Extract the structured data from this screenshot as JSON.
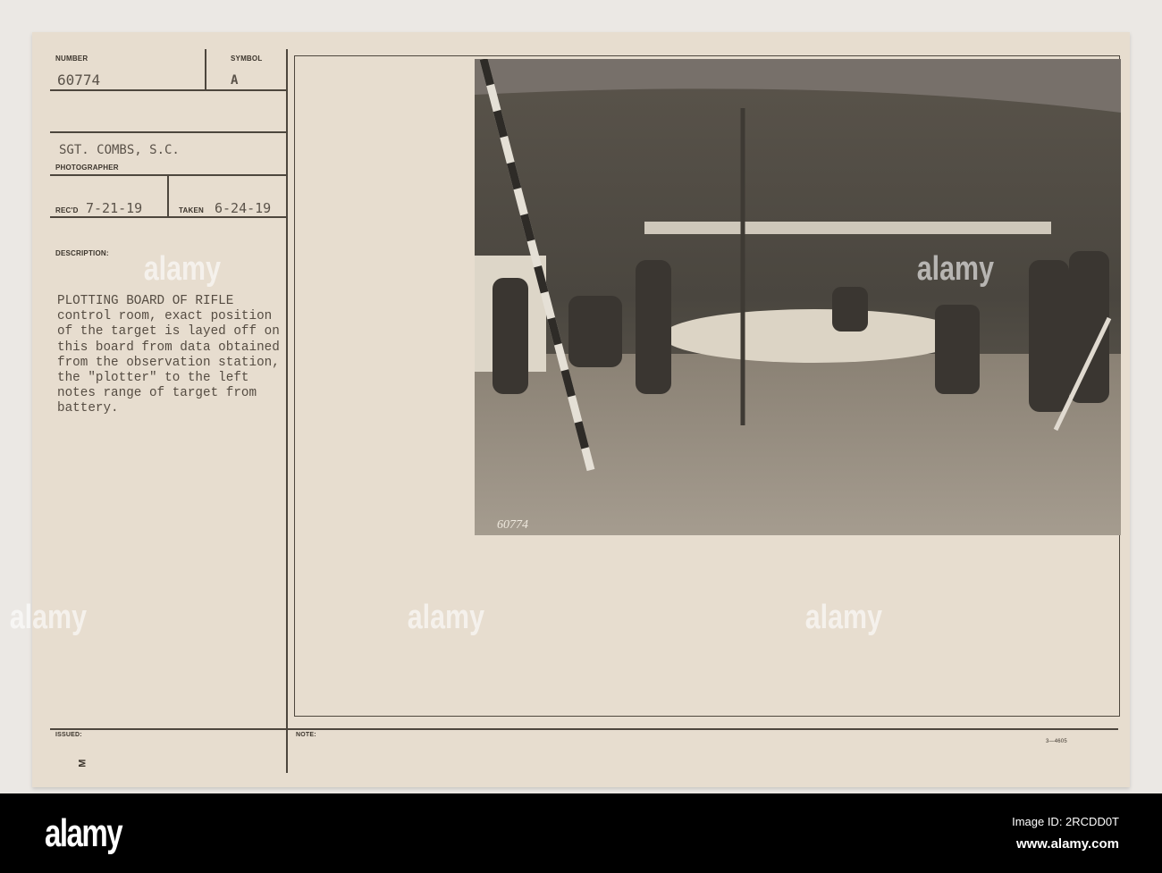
{
  "card": {
    "number_label": "NUMBER",
    "number": "60774",
    "symbol_label": "SYMBOL",
    "symbol": "A",
    "photographer": "SGT. COMBS, S.C.",
    "photographer_label": "PHOTOGRAPHER",
    "recd_label": "REC'D",
    "recd": "7-21-19",
    "taken_label": "TAKEN",
    "taken": "6-24-19",
    "description_label": "DESCRIPTION:",
    "description": "PLOTTING BOARD OF RIFLE\ncontrol room, exact position\nof the target is layed off on\nthis board from data obtained\nfrom the observation station,\nthe \"plotter\" to the left\nnotes range of target from\nbattery.",
    "issued_label": "ISSUED:",
    "note_label": "NOTE:",
    "form_number": "3—4605",
    "side_mark": "M",
    "photo_inscription": "60774"
  },
  "watermark": {
    "text": "alamy",
    "image_id": "Image ID: 2RCDD0T",
    "url": "www.alamy.com"
  }
}
